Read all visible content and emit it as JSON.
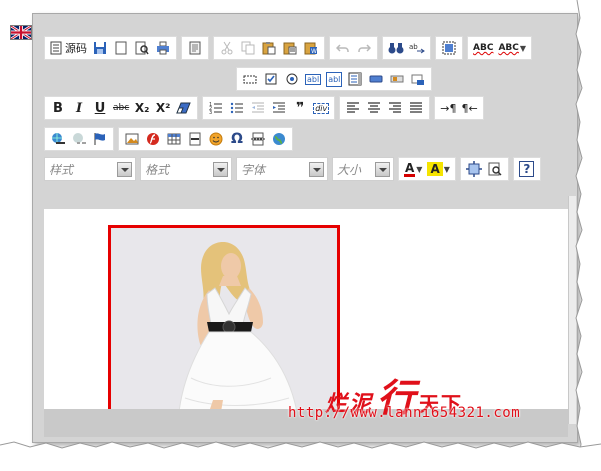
{
  "editor": {
    "language_flag": "united-kingdom-flag-icon",
    "toolbar_row1": [
      {
        "name": "source-button",
        "label": "源码",
        "icon": "source-doc-icon"
      },
      {
        "name": "save-button",
        "icon": "save-disk-icon"
      },
      {
        "name": "new-page-button",
        "icon": "new-page-icon"
      },
      {
        "name": "preview-button",
        "icon": "preview-magnifier-icon"
      },
      {
        "name": "print-button",
        "icon": "printer-icon"
      },
      {
        "name": "templates-button",
        "icon": "templates-icon"
      },
      {
        "name": "cut-button",
        "icon": "scissors-icon",
        "disabled": true
      },
      {
        "name": "copy-button",
        "icon": "copy-icon",
        "disabled": true
      },
      {
        "name": "paste-button",
        "icon": "paste-icon"
      },
      {
        "name": "paste-text-button",
        "icon": "paste-text-icon"
      },
      {
        "name": "paste-word-button",
        "icon": "paste-word-icon"
      },
      {
        "name": "undo-button",
        "icon": "undo-arrow-icon",
        "disabled": true
      },
      {
        "name": "redo-button",
        "icon": "redo-arrow-icon",
        "disabled": true
      },
      {
        "name": "find-button",
        "icon": "binoculars-icon"
      },
      {
        "name": "replace-button",
        "icon": "replace-icon"
      },
      {
        "name": "select-all-button",
        "icon": "select-all-icon"
      },
      {
        "name": "spellcheck-button",
        "label": "ABC",
        "icon": "spellcheck-icon"
      },
      {
        "name": "spellcheck-as-you-type-button",
        "label": "ABC",
        "icon": "spellcheck-dropdown-icon"
      }
    ],
    "toolbar_row2": [
      {
        "name": "form-button",
        "icon": "form-icon"
      },
      {
        "name": "checkbox-button",
        "icon": "checkbox-icon"
      },
      {
        "name": "radio-button",
        "icon": "radio-icon"
      },
      {
        "name": "text-field-button",
        "label": "abl",
        "icon": "textfield-icon"
      },
      {
        "name": "textarea-button",
        "label": "abl",
        "icon": "textarea-icon"
      },
      {
        "name": "select-field-button",
        "icon": "select-list-icon"
      },
      {
        "name": "button-field-button",
        "icon": "button-field-icon"
      },
      {
        "name": "image-button-field-button",
        "icon": "image-button-icon"
      },
      {
        "name": "hidden-field-button",
        "icon": "hidden-field-icon"
      }
    ],
    "toolbar_row3": [
      {
        "name": "bold-button",
        "label": "B"
      },
      {
        "name": "italic-button",
        "label": "I"
      },
      {
        "name": "underline-button",
        "label": "U"
      },
      {
        "name": "strikethrough-button",
        "label": "abc"
      },
      {
        "name": "subscript-button",
        "label": "X₂"
      },
      {
        "name": "superscript-button",
        "label": "X²"
      },
      {
        "name": "remove-format-button",
        "icon": "eraser-icon"
      },
      {
        "name": "numbered-list-button",
        "icon": "numbered-list-icon"
      },
      {
        "name": "bulleted-list-button",
        "icon": "bulleted-list-icon"
      },
      {
        "name": "outdent-button",
        "icon": "outdent-icon",
        "disabled": true
      },
      {
        "name": "indent-button",
        "icon": "indent-icon"
      },
      {
        "name": "blockquote-button",
        "label": "❞"
      },
      {
        "name": "div-container-button",
        "label": "div"
      },
      {
        "name": "align-left-button",
        "icon": "align-left-icon"
      },
      {
        "name": "align-center-button",
        "icon": "align-center-icon"
      },
      {
        "name": "align-right-button",
        "icon": "align-right-icon"
      },
      {
        "name": "justify-button",
        "icon": "justify-icon"
      },
      {
        "name": "ltr-button",
        "label": "¶"
      },
      {
        "name": "rtl-button",
        "label": "¶"
      }
    ],
    "toolbar_row4": [
      {
        "name": "link-button",
        "icon": "globe-link-icon"
      },
      {
        "name": "unlink-button",
        "icon": "unlink-icon",
        "disabled": true
      },
      {
        "name": "anchor-button",
        "icon": "flag-icon"
      },
      {
        "name": "image-button",
        "icon": "image-icon"
      },
      {
        "name": "flash-button",
        "icon": "flash-icon"
      },
      {
        "name": "table-button",
        "icon": "table-icon"
      },
      {
        "name": "horizontal-rule-button",
        "icon": "horizontal-rule-icon"
      },
      {
        "name": "smiley-button",
        "icon": "smiley-icon"
      },
      {
        "name": "special-char-button",
        "label": "Ω"
      },
      {
        "name": "page-break-button",
        "icon": "page-break-icon"
      },
      {
        "name": "iframe-button",
        "icon": "globe-icon"
      }
    ],
    "toolbar_row5": {
      "styles_combo": "样式",
      "format_combo": "格式",
      "font_combo": "字体",
      "size_combo": "大小",
      "text_color_label": "A",
      "bg_color_label": "A",
      "text_color_accent": "#d40000",
      "bg_color_accent": "#f5e400"
    },
    "toolbar_row5_tools": [
      {
        "name": "maximize-button",
        "icon": "maximize-icon"
      },
      {
        "name": "show-blocks-button",
        "icon": "show-blocks-icon"
      },
      {
        "name": "about-button",
        "label": "?"
      }
    ]
  },
  "watermark": {
    "title_a": "烂泥",
    "title_b": "行",
    "title_c": "天下",
    "url": "http://www.lanni654321.com"
  },
  "colors": {
    "frame": "#d4d4d4",
    "image_border": "#e60000",
    "watermark": "#e0101a"
  }
}
